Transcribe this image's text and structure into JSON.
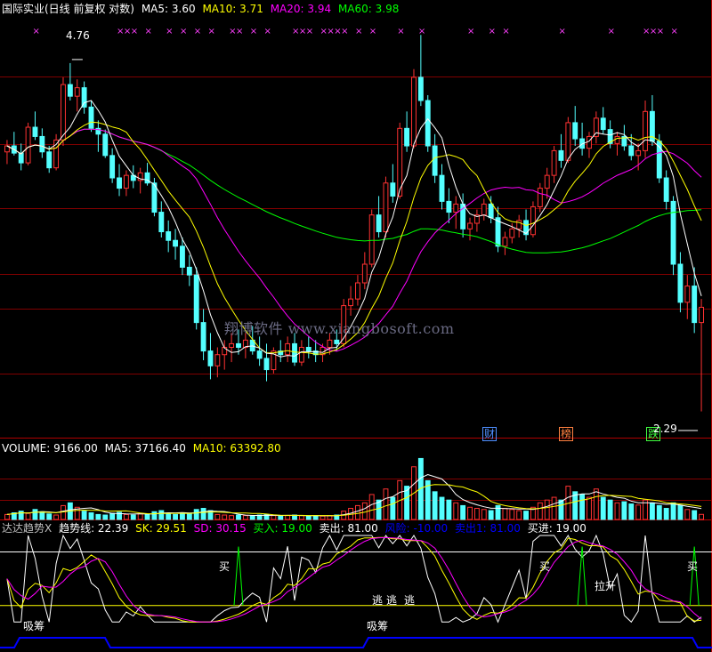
{
  "header": {
    "title": "国际实业(日线 前复权 对数)",
    "ma5": "MA5: 3.60",
    "ma10": "MA10: 3.71",
    "ma20": "MA20: 3.94",
    "ma60": "MA60: 3.98",
    "colors": {
      "title": "#ffffff",
      "ma5": "#ffffff",
      "ma10": "#ffff00",
      "ma20": "#ff00ff",
      "ma60": "#00ff00"
    }
  },
  "price_panel": {
    "high_label": "4.76",
    "low_label": "2.29",
    "event_tags": [
      {
        "text": "财",
        "color": "#4f8fff"
      },
      {
        "text": "榜",
        "color": "#ff8040"
      },
      {
        "text": "跌",
        "color": "#40ff40"
      }
    ]
  },
  "volume_header": {
    "volume": "VOLUME: 9166.00",
    "ma5": "MA5: 37166.40",
    "ma10": "MA10: 63392.80"
  },
  "indicator_header": {
    "name": "达达趋势X",
    "trend": "趋势线: 22.39",
    "sk": "SK: 29.51",
    "sd": "SD: 30.15",
    "buy": "买入: 19.00",
    "sell": "卖出: 81.00",
    "risk": "风险: -10.00",
    "sell1": "卖出1: 81.00",
    "buy_in": "买进: 19.00"
  },
  "indicator_labels": {
    "buy": "买",
    "escape": "逃",
    "rise": "拉升",
    "absorb": "吸筹"
  },
  "watermark": "翔博软件 www.xiangbosoft.com",
  "chart_data": {
    "type": "candlestick",
    "title": "国际实业(日线 前复权 对数)",
    "ohlc": [
      [
        3.95,
        4.05,
        3.85,
        4.0
      ],
      [
        4.0,
        4.12,
        3.92,
        3.94
      ],
      [
        3.94,
        4.02,
        3.8,
        3.86
      ],
      [
        3.86,
        4.2,
        3.84,
        4.16
      ],
      [
        4.16,
        4.3,
        4.05,
        4.08
      ],
      [
        4.08,
        4.15,
        3.9,
        3.95
      ],
      [
        3.95,
        4.0,
        3.78,
        3.82
      ],
      [
        3.82,
        4.1,
        3.8,
        4.05
      ],
      [
        4.05,
        4.62,
        4.0,
        4.55
      ],
      [
        4.55,
        4.76,
        4.4,
        4.44
      ],
      [
        4.44,
        4.6,
        4.3,
        4.52
      ],
      [
        4.52,
        4.58,
        4.28,
        4.34
      ],
      [
        4.34,
        4.4,
        4.12,
        4.15
      ],
      [
        4.15,
        4.22,
        3.95,
        4.1
      ],
      [
        4.1,
        4.14,
        3.9,
        3.92
      ],
      [
        3.92,
        3.98,
        3.7,
        3.74
      ],
      [
        3.74,
        3.85,
        3.6,
        3.66
      ],
      [
        3.66,
        3.8,
        3.6,
        3.76
      ],
      [
        3.76,
        3.84,
        3.66,
        3.72
      ],
      [
        3.72,
        3.82,
        3.62,
        3.78
      ],
      [
        3.78,
        3.86,
        3.68,
        3.7
      ],
      [
        3.7,
        3.74,
        3.45,
        3.48
      ],
      [
        3.48,
        3.56,
        3.3,
        3.34
      ],
      [
        3.34,
        3.42,
        3.2,
        3.28
      ],
      [
        3.28,
        3.36,
        3.15,
        3.24
      ],
      [
        3.24,
        3.3,
        3.05,
        3.1
      ],
      [
        3.1,
        3.18,
        2.98,
        3.05
      ],
      [
        3.05,
        3.1,
        2.72,
        2.76
      ],
      [
        2.76,
        2.84,
        2.55,
        2.6
      ],
      [
        2.6,
        2.7,
        2.45,
        2.52
      ],
      [
        2.52,
        2.62,
        2.46,
        2.58
      ],
      [
        2.58,
        2.66,
        2.5,
        2.62
      ],
      [
        2.62,
        2.7,
        2.54,
        2.64
      ],
      [
        2.64,
        2.72,
        2.58,
        2.62
      ],
      [
        2.62,
        2.7,
        2.56,
        2.66
      ],
      [
        2.66,
        2.74,
        2.58,
        2.6
      ],
      [
        2.6,
        2.68,
        2.52,
        2.56
      ],
      [
        2.56,
        2.64,
        2.44,
        2.5
      ],
      [
        2.5,
        2.62,
        2.48,
        2.6
      ],
      [
        2.6,
        2.66,
        2.54,
        2.58
      ],
      [
        2.58,
        2.68,
        2.54,
        2.64
      ],
      [
        2.64,
        2.7,
        2.52,
        2.54
      ],
      [
        2.54,
        2.66,
        2.52,
        2.62
      ],
      [
        2.62,
        2.68,
        2.56,
        2.6
      ],
      [
        2.6,
        2.66,
        2.54,
        2.58
      ],
      [
        2.58,
        2.64,
        2.54,
        2.62
      ],
      [
        2.62,
        2.7,
        2.58,
        2.66
      ],
      [
        2.66,
        2.72,
        2.6,
        2.64
      ],
      [
        2.64,
        2.9,
        2.62,
        2.86
      ],
      [
        2.86,
        2.98,
        2.8,
        2.9
      ],
      [
        2.9,
        3.05,
        2.86,
        3.0
      ],
      [
        3.0,
        3.2,
        2.96,
        3.12
      ],
      [
        3.12,
        3.5,
        3.1,
        3.46
      ],
      [
        3.46,
        3.6,
        3.3,
        3.34
      ],
      [
        3.34,
        3.75,
        3.3,
        3.7
      ],
      [
        3.7,
        3.85,
        3.55,
        3.6
      ],
      [
        3.6,
        4.2,
        3.58,
        4.15
      ],
      [
        4.15,
        4.3,
        3.95,
        4.0
      ],
      [
        4.0,
        4.7,
        3.98,
        4.62
      ],
      [
        4.62,
        5.05,
        4.35,
        4.4
      ],
      [
        4.4,
        4.45,
        3.95,
        4.0
      ],
      [
        4.0,
        4.1,
        3.7,
        3.76
      ],
      [
        3.76,
        3.85,
        3.5,
        3.56
      ],
      [
        3.56,
        3.66,
        3.4,
        3.48
      ],
      [
        3.48,
        3.6,
        3.36,
        3.54
      ],
      [
        3.54,
        3.62,
        3.3,
        3.36
      ],
      [
        3.36,
        3.44,
        3.28,
        3.4
      ],
      [
        3.4,
        3.5,
        3.34,
        3.46
      ],
      [
        3.46,
        3.58,
        3.42,
        3.54
      ],
      [
        3.54,
        3.6,
        3.4,
        3.44
      ],
      [
        3.44,
        3.52,
        3.2,
        3.24
      ],
      [
        3.24,
        3.34,
        3.18,
        3.3
      ],
      [
        3.3,
        3.4,
        3.26,
        3.36
      ],
      [
        3.36,
        3.46,
        3.3,
        3.42
      ],
      [
        3.42,
        3.5,
        3.28,
        3.32
      ],
      [
        3.32,
        3.56,
        3.3,
        3.52
      ],
      [
        3.52,
        3.7,
        3.48,
        3.66
      ],
      [
        3.66,
        3.82,
        3.58,
        3.76
      ],
      [
        3.76,
        4.0,
        3.7,
        3.96
      ],
      [
        3.96,
        4.1,
        3.82,
        3.88
      ],
      [
        3.88,
        4.25,
        3.86,
        4.2
      ],
      [
        4.2,
        4.35,
        4.0,
        4.06
      ],
      [
        4.06,
        4.2,
        3.92,
        3.98
      ],
      [
        3.98,
        4.12,
        3.9,
        4.08
      ],
      [
        4.08,
        4.3,
        4.02,
        4.24
      ],
      [
        4.24,
        4.34,
        4.1,
        4.14
      ],
      [
        4.14,
        4.22,
        3.98,
        4.02
      ],
      [
        4.02,
        4.12,
        3.92,
        4.08
      ],
      [
        4.08,
        4.18,
        3.96,
        4.0
      ],
      [
        4.0,
        4.1,
        3.88,
        3.92
      ],
      [
        3.92,
        4.02,
        3.8,
        3.96
      ],
      [
        3.96,
        4.4,
        3.9,
        4.3
      ],
      [
        4.3,
        4.45,
        4.0,
        4.04
      ],
      [
        4.04,
        4.1,
        3.7,
        3.74
      ],
      [
        3.74,
        3.8,
        3.5,
        3.56
      ],
      [
        3.56,
        3.6,
        3.05,
        3.12
      ],
      [
        3.12,
        3.2,
        2.82,
        2.88
      ],
      [
        2.88,
        3.05,
        2.78,
        2.98
      ],
      [
        2.98,
        3.1,
        2.7,
        2.76
      ],
      [
        2.76,
        2.9,
        2.29,
        2.85
      ]
    ],
    "volume": [
      9000,
      12000,
      15000,
      11000,
      18000,
      14000,
      10000,
      8000,
      25000,
      30000,
      22000,
      15000,
      12000,
      9000,
      8000,
      11000,
      13000,
      9000,
      8000,
      10000,
      9000,
      14000,
      16000,
      11000,
      9000,
      12000,
      10000,
      18000,
      20000,
      16000,
      9000,
      8000,
      7000,
      8000,
      7000,
      6000,
      8000,
      9000,
      7000,
      6000,
      7000,
      8000,
      7000,
      6000,
      7000,
      6000,
      7000,
      8000,
      15000,
      20000,
      25000,
      30000,
      45000,
      35000,
      55000,
      40000,
      70000,
      60000,
      95000,
      110000,
      70000,
      50000,
      40000,
      35000,
      30000,
      25000,
      22000,
      20000,
      18000,
      16000,
      25000,
      20000,
      18000,
      16000,
      15000,
      22000,
      30000,
      35000,
      40000,
      35000,
      60000,
      50000,
      45000,
      40000,
      55000,
      40000,
      35000,
      30000,
      32000,
      28000,
      26000,
      35000,
      30000,
      25000,
      20000,
      30000,
      25000,
      18000,
      16000,
      9166
    ],
    "ma": {
      "ma5": 3.6,
      "ma10": 3.71,
      "ma20": 3.94,
      "ma60": 3.98
    },
    "indicator": {
      "trend": 22.39,
      "sk": 29.51,
      "sd": 30.15,
      "buy": 19.0,
      "sell": 81.0,
      "risk": -10.0
    },
    "colors": {
      "up": "#ff3232",
      "down": "#54ffff",
      "ma5": "#ffffff",
      "ma10": "#ffff00",
      "ma20": "#ff00ff",
      "ma60": "#00ff00",
      "grid": "#800000"
    }
  }
}
